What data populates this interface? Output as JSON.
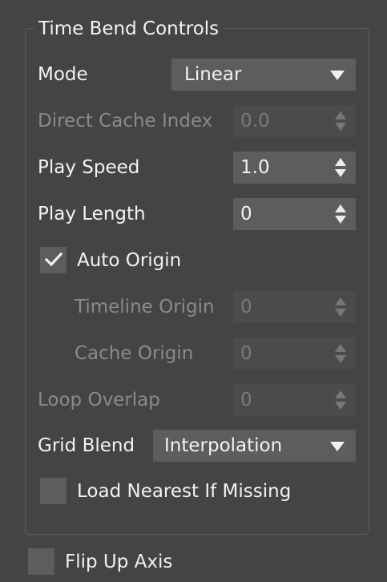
{
  "panel": {
    "title": "Time Bend Controls"
  },
  "mode": {
    "label": "Mode",
    "value": "Linear"
  },
  "direct_cache_index": {
    "label": "Direct Cache Index",
    "value": "0.0",
    "enabled": false
  },
  "play_speed": {
    "label": "Play Speed",
    "value": "1.0"
  },
  "play_length": {
    "label": "Play Length",
    "value": "0"
  },
  "auto_origin": {
    "label": "Auto Origin",
    "checked": true
  },
  "timeline_origin": {
    "label": "Timeline Origin",
    "value": "0",
    "enabled": false
  },
  "cache_origin": {
    "label": "Cache Origin",
    "value": "0",
    "enabled": false
  },
  "loop_overlap": {
    "label": "Loop Overlap",
    "value": "0",
    "enabled": false
  },
  "grid_blend": {
    "label": "Grid Blend",
    "value": "Interpolation"
  },
  "load_nearest": {
    "label": "Load Nearest If Missing",
    "checked": false
  },
  "flip_up_axis": {
    "label": "Flip Up Axis",
    "checked": false
  },
  "colors": {
    "background": "#444444",
    "control": "#5d5d5d",
    "control_disabled": "#4b4b4b",
    "text": "#f2f2f2",
    "text_disabled": "#8a8a8a"
  }
}
